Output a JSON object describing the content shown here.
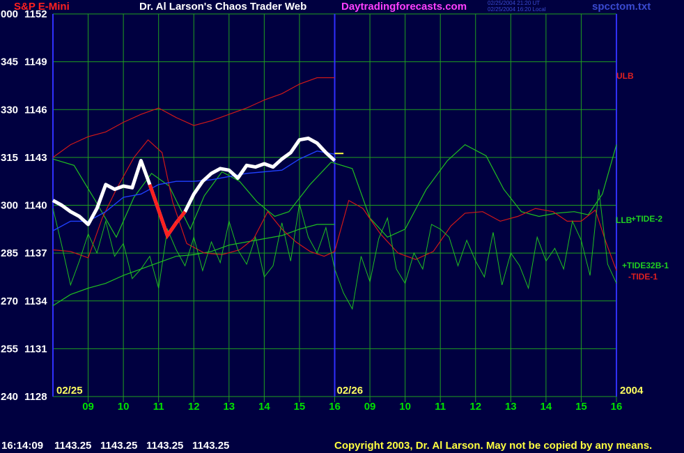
{
  "header": {
    "instrument": "S&P E-Mini",
    "title": "Dr. Al Larson's Chaos Trader Web",
    "site": "Daytradingforecasts.com",
    "stamp_utc": "02/25/2004 21:20 UT",
    "stamp_local": "02/25/2004 16:20 Local",
    "file": "spcctom.txt"
  },
  "footer": {
    "time": "16:14:09",
    "ohlc": [
      "1143.25",
      "1143.25",
      "1143.25",
      "1143.25"
    ],
    "copyright": "Copyright 2003, Dr. Al Larson. May not be copied by any means."
  },
  "colors": {
    "background": "#000040",
    "grid": "#1fa01f",
    "axis_text": "#ffffff",
    "day_divider": "#3030ff",
    "price_up": "#ffffff",
    "price_down": "#ff2020",
    "bands": "#d01818",
    "tide": "#20c020",
    "instrument": "#ff2020",
    "site": "#ff40ff",
    "file": "#3a4ad0"
  },
  "chart_data": {
    "type": "line",
    "y_left_ticks": [
      "000",
      "345",
      "330",
      "315",
      "300",
      "285",
      "270",
      "255",
      "240"
    ],
    "y_right_ticks": [
      "1152",
      "1149",
      "1146",
      "1143",
      "1140",
      "1137",
      "1134",
      "1131",
      "1128"
    ],
    "ylim": [
      1128,
      1152
    ],
    "x_ticks": [
      "09",
      "10",
      "11",
      "12",
      "13",
      "14",
      "15",
      "16",
      "09",
      "10",
      "11",
      "12",
      "13",
      "14",
      "15",
      "16"
    ],
    "date_labels": [
      "02/25",
      "02/26"
    ],
    "year_label": "2004",
    "series_labels": [
      {
        "name": "ULB",
        "color": "#e02020"
      },
      {
        "name": "LLB",
        "color": "#20d020"
      },
      {
        "name": "+TIDE-2",
        "color": "#20d020"
      },
      {
        "name": "+TIDE32B-1",
        "color": "#20d020"
      },
      {
        "name": "-TIDE-1",
        "color": "#e02020"
      }
    ],
    "series": [
      {
        "name": "ULB",
        "x": [
          8.0,
          8.5,
          9.0,
          9.5,
          10.0,
          10.5,
          11.0,
          11.5,
          12.0,
          12.5,
          13.0,
          13.5,
          14.0,
          14.5,
          15.0,
          15.5,
          16.0
        ],
        "y": [
          1143.0,
          1143.8,
          1144.3,
          1144.6,
          1145.2,
          1145.7,
          1146.1,
          1145.5,
          1145.0,
          1145.3,
          1145.7,
          1146.1,
          1146.6,
          1147.0,
          1147.6,
          1148.0,
          1148.0
        ]
      },
      {
        "name": "LLB",
        "x": [
          8.0,
          8.5,
          9.0,
          9.5,
          10.0,
          10.5,
          11.0,
          11.5,
          12.0,
          12.5,
          13.0,
          13.5,
          14.0,
          14.5,
          15.0,
          15.5,
          16.0
        ],
        "y": [
          1133.7,
          1134.4,
          1134.8,
          1135.1,
          1135.6,
          1136.0,
          1136.4,
          1136.8,
          1136.9,
          1137.1,
          1137.5,
          1137.7,
          1137.9,
          1138.1,
          1138.5,
          1138.8,
          1138.8
        ]
      },
      {
        "name": "+TIDE-2",
        "x": [
          8.0,
          8.6,
          9.2,
          9.8,
          10.3,
          10.8,
          11.3,
          11.9,
          12.3,
          12.8,
          13.3,
          13.8,
          14.3,
          14.7,
          15.3,
          15.9,
          16.5,
          17.0,
          17.5,
          18.0,
          18.6,
          19.2,
          19.7,
          20.3,
          20.8,
          21.3,
          21.8,
          22.3,
          22.8,
          23.2,
          23.6,
          24.0
        ],
        "y": [
          1142.9,
          1142.5,
          1140.3,
          1138.0,
          1140.5,
          1142.0,
          1141.2,
          1138.5,
          1140.6,
          1142.1,
          1141.5,
          1140.2,
          1139.3,
          1139.6,
          1141.3,
          1142.7,
          1142.3,
          1139.2,
          1138.0,
          1138.5,
          1141.0,
          1142.8,
          1143.8,
          1143.1,
          1141.0,
          1139.6,
          1139.3,
          1139.5,
          1139.6,
          1139.4,
          1140.7,
          1143.8
        ]
      },
      {
        "name": "-TIDE-1",
        "x": [
          8.0,
          8.5,
          9.0,
          9.4,
          9.8,
          10.3,
          10.7,
          11.1,
          11.4,
          11.8,
          12.3,
          12.8,
          13.3,
          13.7,
          14.1,
          14.5,
          14.9,
          15.3,
          15.7,
          16.0,
          16.4,
          16.8,
          17.3,
          17.8,
          18.3,
          18.8,
          19.3,
          19.7,
          20.2,
          20.7,
          21.2,
          21.7,
          22.2,
          22.6,
          23.0,
          23.4,
          23.7,
          24.0
        ],
        "y": [
          1137.2,
          1137.1,
          1136.7,
          1139.2,
          1141.0,
          1143.0,
          1144.1,
          1143.3,
          1140.2,
          1137.6,
          1137.0,
          1136.9,
          1137.2,
          1137.9,
          1139.6,
          1138.5,
          1137.7,
          1137.1,
          1136.8,
          1137.1,
          1140.3,
          1139.8,
          1138.2,
          1137.0,
          1136.6,
          1137.1,
          1138.7,
          1139.5,
          1139.6,
          1139.0,
          1139.3,
          1139.8,
          1139.6,
          1139.0,
          1139.0,
          1139.7,
          1137.7,
          1135.9
        ]
      },
      {
        "name": "+TIDE32B-1",
        "x": [
          8.0,
          8.25,
          8.5,
          8.75,
          9.0,
          9.25,
          9.5,
          9.75,
          10.0,
          10.25,
          10.5,
          10.75,
          11.0,
          11.25,
          11.5,
          11.75,
          12.0,
          12.25,
          12.5,
          12.75,
          13.0,
          13.25,
          13.5,
          13.75,
          14.0,
          14.25,
          14.5,
          14.75,
          15.0,
          15.25,
          15.5,
          15.75,
          16.0,
          16.25,
          16.5,
          16.75,
          17.0,
          17.25,
          17.5,
          17.75,
          18.0,
          18.25,
          18.5,
          18.75,
          19.0,
          19.25,
          19.5,
          19.75,
          20.0,
          20.25,
          20.5,
          20.75,
          21.0,
          21.25,
          21.5,
          21.75,
          22.0,
          22.25,
          22.5,
          22.75,
          23.0,
          23.25,
          23.5,
          23.75,
          24.0
        ],
        "y": [
          1139.8,
          1137.5,
          1135.0,
          1136.5,
          1138.2,
          1137.0,
          1139.0,
          1136.8,
          1137.6,
          1135.4,
          1136.0,
          1136.8,
          1134.8,
          1138.5,
          1137.2,
          1136.2,
          1138.0,
          1135.9,
          1137.7,
          1136.4,
          1139.0,
          1137.2,
          1136.3,
          1138.0,
          1135.5,
          1136.2,
          1138.9,
          1136.5,
          1140.1,
          1138.0,
          1137.0,
          1138.6,
          1136.0,
          1134.5,
          1133.5,
          1136.8,
          1135.2,
          1137.9,
          1139.2,
          1136.0,
          1135.1,
          1137.0,
          1136.0,
          1138.8,
          1138.5,
          1138.0,
          1136.2,
          1137.8,
          1136.5,
          1135.5,
          1138.3,
          1135.0,
          1137.0,
          1136.2,
          1134.8,
          1138.0,
          1136.5,
          1137.3,
          1136.0,
          1139.0,
          1137.8,
          1135.6,
          1141.0,
          1136.3,
          1135.1
        ]
      },
      {
        "name": "average",
        "x": [
          8.0,
          8.5,
          9.0,
          9.5,
          10.0,
          10.5,
          11.0,
          11.5,
          12.0,
          12.5,
          13.0,
          13.5,
          14.0,
          14.5,
          15.0,
          15.5,
          16.0
        ],
        "y": [
          1138.4,
          1139.0,
          1139.0,
          1139.6,
          1140.5,
          1140.7,
          1141.3,
          1141.5,
          1141.5,
          1141.6,
          1141.8,
          1142.0,
          1142.1,
          1142.2,
          1142.9,
          1143.4,
          1143.2
        ]
      },
      {
        "name": "price",
        "x": [
          8.0,
          8.25,
          8.5,
          8.75,
          9.0,
          9.25,
          9.5,
          9.75,
          10.0,
          10.25,
          10.5,
          10.75,
          11.0,
          11.25,
          11.5,
          11.75,
          12.0,
          12.25,
          12.5,
          12.75,
          13.0,
          13.25,
          13.5,
          13.75,
          14.0,
          14.25,
          14.5,
          14.75,
          15.0,
          15.25,
          15.5,
          15.75,
          16.0
        ],
        "y": [
          1140.3,
          1140.0,
          1139.6,
          1139.3,
          1138.8,
          1139.8,
          1141.3,
          1141.0,
          1141.2,
          1141.1,
          1142.8,
          1141.3,
          1139.7,
          1138.1,
          1138.9,
          1139.6,
          1140.7,
          1141.5,
          1142.0,
          1142.3,
          1142.2,
          1141.7,
          1142.5,
          1142.4,
          1142.6,
          1142.4,
          1142.9,
          1143.3,
          1144.1,
          1144.2,
          1143.9,
          1143.3,
          1142.8
        ],
        "down_segments": [
          [
            9.15,
            9.35
          ],
          [
            9.95,
            10.1
          ],
          [
            10.8,
            11.45
          ],
          [
            11.6,
            11.8
          ],
          [
            15.9,
            16.0
          ]
        ]
      },
      {
        "name": "last",
        "x": [
          16.0,
          16.25
        ],
        "y": [
          1143.25,
          1143.25
        ]
      }
    ]
  }
}
